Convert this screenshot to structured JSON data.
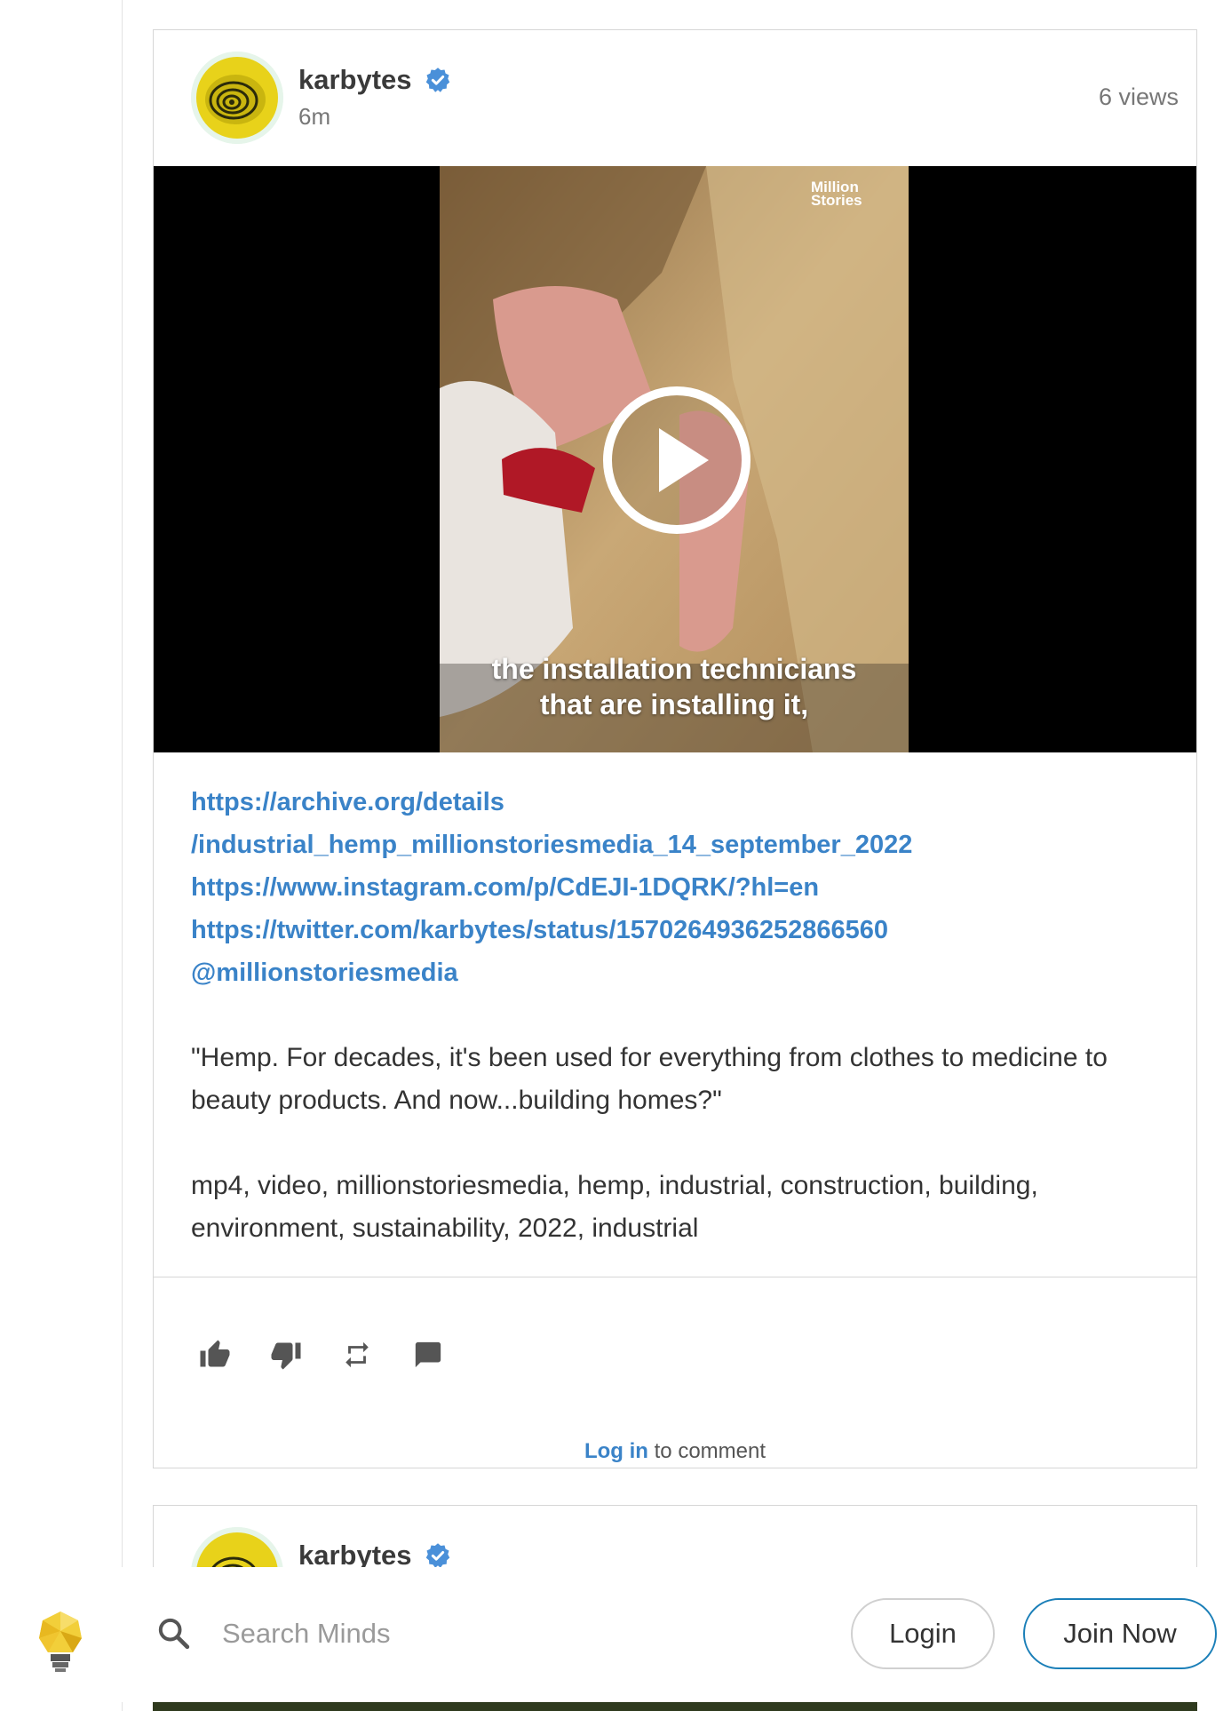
{
  "post": {
    "author": "karbytes",
    "time": "6m",
    "views": "6 views",
    "video": {
      "brand_line1": "Million",
      "brand_line2": "Stories",
      "caption_line1": "the installation technicians",
      "caption_line2": "that are installing it,"
    },
    "links": [
      "https://archive.org/details",
      "/industrial_hemp_millionstoriesmedia_14_september_2022",
      "https://www.instagram.com/p/CdEJI-1DQRK/?hl=en",
      "https://twitter.com/karbytes/status/1570264936252866560",
      "@millionstoriesmedia"
    ],
    "quote": "\"Hemp. For decades, it's been used for everything from clothes to medicine to beauty products. And now...building homes?\"",
    "tags": "mp4, video, millionstoriesmedia, hemp, industrial, construction, building, environment, sustainability, 2022, industrial",
    "comment_login": "Log in",
    "comment_suffix": " to comment"
  },
  "next_post": {
    "author": "karbytes"
  },
  "bottom_bar": {
    "search_placeholder": "Search Minds",
    "login_label": "Login",
    "join_label": "Join Now"
  },
  "colors": {
    "link": "#3a83c8",
    "verified": "#4a90d9",
    "join_border": "#1b7fb8"
  }
}
